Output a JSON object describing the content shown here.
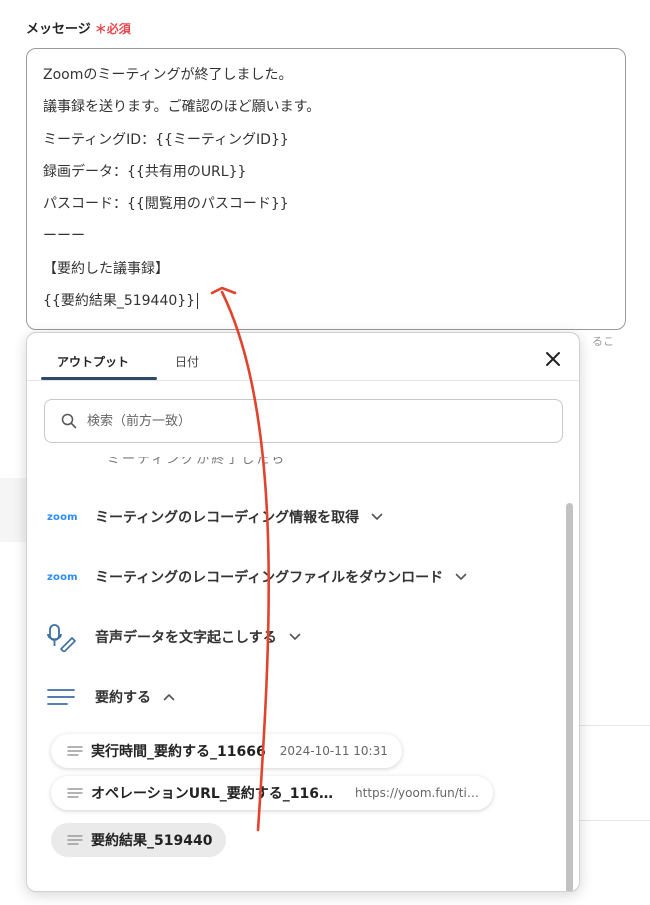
{
  "field": {
    "label": "メッセージ",
    "required_mark": "＊必須"
  },
  "message_lines": [
    "Zoomのミーティングが終了しました。",
    "議事録を送ります。ご確認のほど願います。",
    "ミーティングID：{{ミーティングID}}",
    "録画データ：{{共有用のURL}}",
    "パスコード：{{閲覧用のパスコード}}",
    "ーーー",
    "【要約した議事録】",
    "{{要約結果_519440}}"
  ],
  "side_hint": "るこ",
  "popup": {
    "tabs": [
      {
        "label": "アウトプット",
        "active": true
      },
      {
        "label": "日付",
        "active": false
      }
    ],
    "search_placeholder": "検索（前方一致）",
    "cut_off_row": "ミーティングが終了したら",
    "operations": [
      {
        "icon": "zoom-logo",
        "logo_text": "zoom",
        "label": "ミーティングのレコーディング情報を取得",
        "expanded": false
      },
      {
        "icon": "zoom-logo",
        "logo_text": "zoom",
        "label": "ミーティングのレコーディングファイルをダウンロード",
        "expanded": false
      },
      {
        "icon": "microphone-pen-icon",
        "label": "音声データを文字起こしする",
        "expanded": false
      },
      {
        "icon": "summary-lines-icon",
        "label": "要約する",
        "expanded": true
      }
    ],
    "summary_outputs": [
      {
        "name": "実行時間_要約する_11666",
        "value": "2024-10-11 10:31",
        "selected": false
      },
      {
        "name": "オペレーションURL_要約する_116…",
        "value": "https://yoom.fun/ti…",
        "selected": false
      },
      {
        "name": "要約結果_519440",
        "value": "",
        "selected": true
      }
    ]
  },
  "colors": {
    "required": "#e5484d",
    "tab_underline": "#2d4a6b",
    "zoom_blue": "#2d8cff",
    "icon_blue": "#3d6fa3",
    "arrow_red": "#e0432e"
  }
}
